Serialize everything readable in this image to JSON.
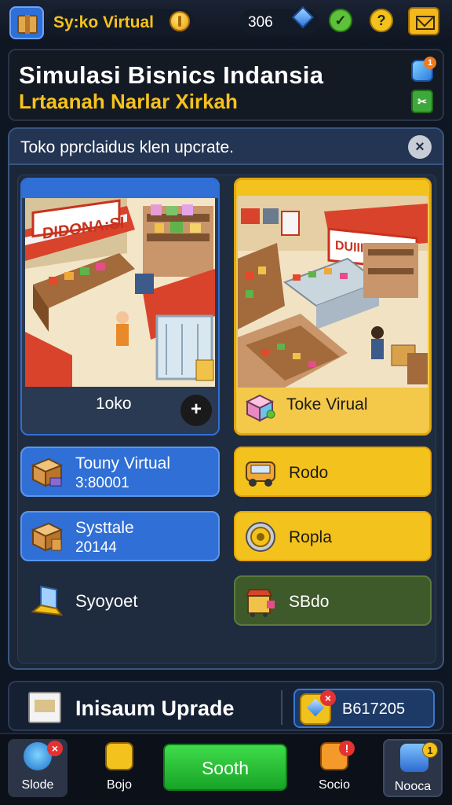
{
  "topbar": {
    "title": "Sy:ko Virtual",
    "gems": "306",
    "help_glyph": "?",
    "action_glyph": "✓"
  },
  "header": {
    "title": "Simulasi Bisnics Indansia",
    "subtitle": "Lrtaanah Narlar Xirkah",
    "badge_count": "1"
  },
  "main": {
    "banner_text": "Toko pprclaidus klen upcrate.",
    "close_glyph": "×",
    "cards": [
      {
        "label": "1oko",
        "sign": "DIDONA:SI",
        "action_glyph": "+"
      },
      {
        "label": "Toke Virual",
        "sign": "DUIIIHIH"
      }
    ],
    "list": [
      {
        "title": "Touny Virtual",
        "value": "3:80001",
        "style": "blue"
      },
      {
        "title": "Rodo",
        "style": "gold"
      },
      {
        "title": "Systtale",
        "value": "20144",
        "style": "blue"
      },
      {
        "title": "Ropla",
        "style": "gold"
      },
      {
        "title": "Syoyoet",
        "style": "plain"
      },
      {
        "title": "SBdo",
        "style": "green"
      }
    ]
  },
  "upgrade": {
    "title": "Inisaum Uprade",
    "value": "B617205",
    "badge": "×"
  },
  "nav": {
    "items": [
      {
        "label": "Slode",
        "badge": "×"
      },
      {
        "label": "Bojo"
      },
      {
        "label": "Sooth"
      },
      {
        "label": "Socio",
        "badge": "!"
      },
      {
        "label": "Nooca",
        "badge": "1"
      }
    ]
  },
  "colors": {
    "accent_blue": "#2f6fd6",
    "accent_gold": "#f4c21d",
    "accent_green": "#2ec43a",
    "background": "#0e1624"
  }
}
